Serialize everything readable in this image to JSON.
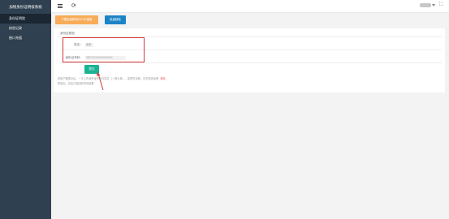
{
  "sidebar": {
    "title": "加钱身份证明核系统",
    "items": [
      {
        "label": "身份证明验"
      },
      {
        "label": "核验记录"
      },
      {
        "label": "接口充值"
      }
    ]
  },
  "toolbar": {
    "download_label": "下载批量核验EXCEL模板",
    "batch_label": "批量核验"
  },
  "form": {
    "title": "身份证核验",
    "name_label": "姓名：",
    "name_value": "某某",
    "id_label": "身份证号码：",
    "id_value": "3307XXXXXXXXXXXX",
    "submit_label": "提交"
  },
  "notes": {
    "line1": "核验户籍核对后，一次上传身份证号码与姓名（一致为真），如预付余额，请先检查余额",
    "tag": "核验",
    "line2": "核验后，仅支付返回的有效结果"
  },
  "colors": {
    "sidebar_bg": "#2f4050",
    "download_btn": "#f8ac59",
    "batch_btn": "#1c84c6",
    "submit_btn": "#1ab394",
    "highlight": "#d7343a"
  }
}
